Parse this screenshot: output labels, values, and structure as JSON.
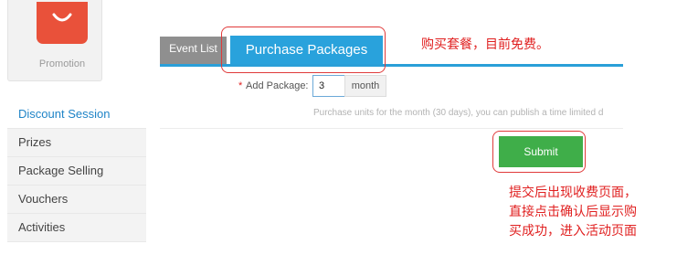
{
  "sidebar": {
    "promo": {
      "label": "Promotion",
      "icon": "shopping-bag-icon",
      "color": "#e9513a"
    },
    "items": [
      {
        "label": "Discount Session",
        "active": true
      },
      {
        "label": "Prizes"
      },
      {
        "label": "Package Selling"
      },
      {
        "label": "Vouchers"
      },
      {
        "label": "Activities"
      }
    ]
  },
  "main": {
    "tabs": [
      {
        "label": "Event List"
      },
      {
        "label": "Purchase Packages",
        "active": true
      }
    ],
    "form": {
      "add_package_label": "Add Package:",
      "required_marker": "*",
      "quantity_value": "3",
      "unit_label": "month",
      "hint": "Purchase units for the month (30 days), you can publish a time limited d"
    },
    "submit_label": "Submit"
  },
  "annotations": {
    "tab_note": "购买套餐，目前免费。",
    "submit_note": [
      "提交后出现收费页面，",
      "直接点击确认后显示购",
      "买成功，进入活动页面"
    ]
  },
  "colors": {
    "accent": "#29a2dc",
    "submit": "#3fae49",
    "annotation": "#e02020"
  }
}
